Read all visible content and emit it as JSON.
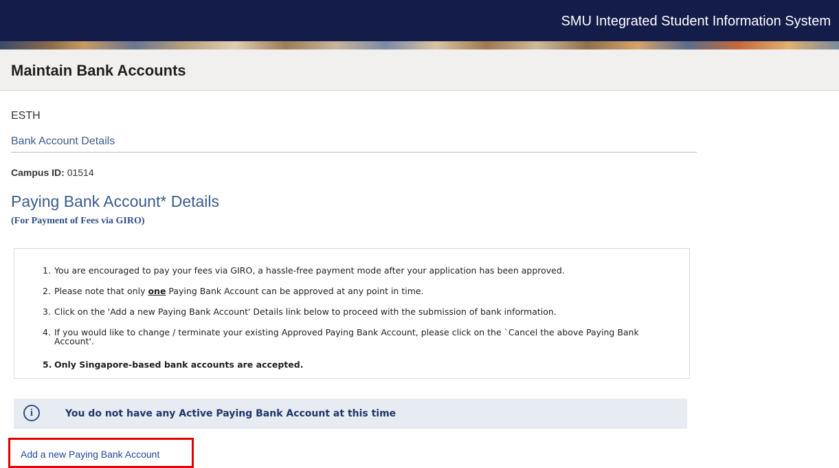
{
  "topbar": {
    "system_title": "SMU Integrated Student Information System"
  },
  "header": {
    "page_title": "Maintain Bank Accounts"
  },
  "main": {
    "user_name": "ESTH",
    "section_link": "Bank Account Details",
    "campus_id_label": "Campus ID:",
    "campus_id_value": "01514",
    "paying_title": "Paying Bank Account* Details",
    "paying_subtitle": "(For Payment of Fees via GIRO)",
    "instructions": [
      {
        "num": "1.",
        "text": "You are encouraged to pay your fees via GIRO, a hassle-free payment mode after your application has been approved."
      },
      {
        "num": "2.",
        "text_before": "Please note that only ",
        "emphasis": "one",
        "text_after": " Paying Bank Account can be approved at any point in time."
      },
      {
        "num": "3.",
        "text": "Click on the 'Add a new Paying Bank Account' Details link below to proceed with the submission of bank information."
      },
      {
        "num": "4.",
        "text": "If you would like to change / terminate your existing Approved Paying Bank Account, please click on the `Cancel the above Paying Bank Account'."
      },
      {
        "num": "5.",
        "text": "Only Singapore-based bank accounts are accepted."
      }
    ],
    "info_message": "You do not have any Active Paying Bank Account at this time",
    "add_link": "Add a new Paying Bank Account"
  },
  "colors": {
    "topbar": "#141c4a",
    "link": "#3b5b8e",
    "highlight": "#e00000"
  }
}
